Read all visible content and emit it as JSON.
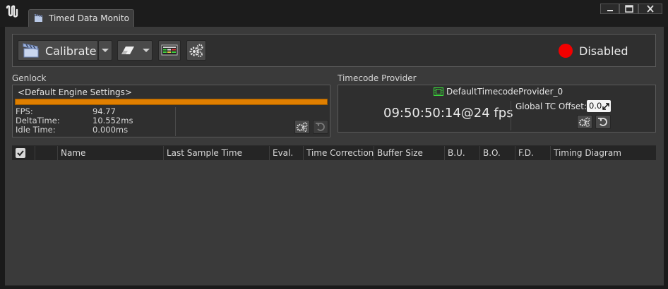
{
  "window": {
    "tab_title": "Timed Data Monito",
    "controls": [
      "minimize-icon",
      "maximize-icon",
      "close-icon"
    ]
  },
  "toolbar": {
    "calibrate_label": "Calibrate",
    "status_label": "Disabled",
    "status_color": "#f20000",
    "icons": [
      "clapperboard-icon",
      "eraser-icon",
      "table-view-icon",
      "gears-icon"
    ]
  },
  "genlock": {
    "section_label": "Genlock",
    "source_name": "<Default Engine Settings>",
    "bar_color": "#e07f00",
    "stats": {
      "fps_label": "FPS:",
      "fps_value": "94.77",
      "delta_label": "DeltaTime:",
      "delta_value": "10.552ms",
      "idle_label": "Idle Time:",
      "idle_value": "0.000ms"
    }
  },
  "timecode": {
    "section_label": "Timecode Provider",
    "provider_name": "DefaultTimecodeProvider_0",
    "time_value": "09:50:50:14@24 fps",
    "offset_label": "Global TC Offset:",
    "offset_value": "0.0"
  },
  "table": {
    "columns": [
      "Name",
      "Last Sample Time",
      "Eval.",
      "Time Correction",
      "Buffer Size",
      "B.U.",
      "B.O.",
      "F.D.",
      "Timing Diagram"
    ]
  }
}
